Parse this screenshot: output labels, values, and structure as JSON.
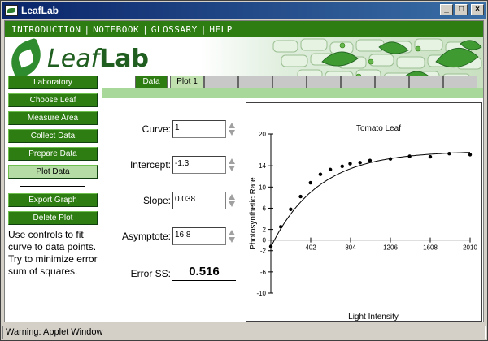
{
  "window": {
    "title": "LeafLab"
  },
  "menu": {
    "items": [
      "INTRODUCTION",
      "NOTEBOOK",
      "GLOSSARY",
      "HELP"
    ]
  },
  "logo": {
    "part1": "Leaf",
    "part2": "Lab"
  },
  "tabs": {
    "data_label": "Data",
    "plot_label": "Plot 1"
  },
  "sidebar": {
    "buttons": [
      "Laboratory",
      "Choose Leaf",
      "Measure Area",
      "Collect Data",
      "Prepare Data",
      "Plot Data"
    ],
    "actions": [
      "Export Graph",
      "Delete Plot"
    ],
    "help": "Use controls to fit curve to data points. Try to minimize error sum of squares."
  },
  "controls": {
    "curve": {
      "label": "Curve:",
      "value": "1"
    },
    "intercept": {
      "label": "Intercept:",
      "value": "-1.3"
    },
    "slope": {
      "label": "Slope:",
      "value": "0.038"
    },
    "asymptote": {
      "label": "Asymptote:",
      "value": "16.8"
    },
    "error": {
      "label": "Error SS:",
      "value": "0.516"
    }
  },
  "status": {
    "text": "Warning: Applet Window"
  },
  "colors": {
    "accent": "#2e7d12",
    "title": "#0a246a"
  },
  "chart_data": {
    "type": "scatter",
    "title": "Tomato Leaf",
    "xlabel": "Light Intensity",
    "ylabel": "Photosynthetic Rate",
    "xlim": [
      0,
      2010
    ],
    "ylim": [
      -10,
      20
    ],
    "xticks": [
      402,
      804,
      1206,
      1608,
      2010
    ],
    "yticks": [
      -10,
      -6,
      -2,
      0,
      2,
      6,
      10,
      14,
      20
    ],
    "points": [
      {
        "x": 0,
        "y": -1.2
      },
      {
        "x": 100,
        "y": 2.5
      },
      {
        "x": 200,
        "y": 5.8
      },
      {
        "x": 300,
        "y": 8.2
      },
      {
        "x": 400,
        "y": 10.8
      },
      {
        "x": 500,
        "y": 12.4
      },
      {
        "x": 600,
        "y": 13.3
      },
      {
        "x": 720,
        "y": 13.9
      },
      {
        "x": 800,
        "y": 14.4
      },
      {
        "x": 900,
        "y": 14.6
      },
      {
        "x": 1000,
        "y": 15.0
      },
      {
        "x": 1206,
        "y": 15.3
      },
      {
        "x": 1400,
        "y": 15.8
      },
      {
        "x": 1608,
        "y": 15.7
      },
      {
        "x": 1800,
        "y": 16.3
      },
      {
        "x": 2010,
        "y": 16.1
      }
    ],
    "fit": {
      "intercept": -1.3,
      "slope": 0.038,
      "asymptote": 16.8
    }
  }
}
